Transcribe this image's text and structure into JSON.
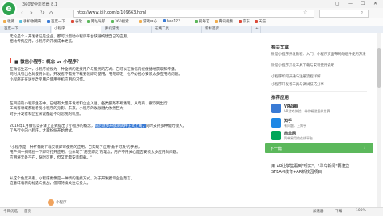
{
  "window": {
    "title": "360安全浏览器 8.1",
    "logo": "e",
    "controls": [
      "▢",
      "—",
      "☐",
      "✕"
    ]
  },
  "address": {
    "url": "http://www.itilr.com/p/109663.html",
    "nav_icons": [
      "back-icon",
      "forward-icon",
      "refresh-icon",
      "home-icon"
    ],
    "search_placeholder": ""
  },
  "bookmarks": [
    {
      "label": "收藏",
      "color": "#f0ad4e"
    },
    {
      "label": "手机收藏夹",
      "color": "#5bc0de"
    },
    {
      "label": "百度一下",
      "color": "#3a7bd5"
    },
    {
      "label": "谷歌",
      "color": "#dd4b39"
    },
    {
      "label": "网址导航",
      "color": "#5cb85c"
    },
    {
      "label": "360搜索",
      "color": "#5cb85c"
    },
    {
      "label": "游戏中心",
      "color": "#f0ad4e"
    },
    {
      "label": "hao123",
      "color": "#3a7bd5"
    },
    {
      "label": "爱奇艺",
      "color": "#5cb85c"
    },
    {
      "label": "腾讯视频",
      "color": "#f0ad4e"
    },
    {
      "label": "京东",
      "color": "#dd4b39"
    },
    {
      "label": "天猫",
      "color": "#dd4b39"
    }
  ],
  "tabs": [
    {
      "label": "百度一下",
      "active": false
    },
    {
      "label": "小程序",
      "active": true
    },
    {
      "label": "手机游戏",
      "active": false
    },
    {
      "label": "在线工具",
      "active": false
    },
    {
      "label": "新标签页",
      "active": false
    },
    {
      "label": "+",
      "active": false
    }
  ],
  "article": {
    "intro": [
      "无论是个人开发者还是企业，都可以借助小程序平台快速构建自己的应用。",
      "相比传统应用，小程序的开发成本更低。"
    ],
    "section_title": "■ 微信小程序：概念 or 小程序？",
    "paragraphs": [
      [
        "在微信生态中，小程序被视为一种全新的连接用户与服务的方式。它可以在微信内被便捷地获取和传播，",
        "同时具有出色的使用体验。开发者不需要下载安装即可使用，用完即走，也不必担心安装太多应用的问题。",
        "小程序正在逐步改变用户使用手机应用的习惯。"
      ],
      [
        "在目前的小程序生态中，已经有大量开发者和企业入驻，各类服务不断涌现，从电商、餐饮到出行、",
        "工具等领域都能看到小程序的身影。未来，小程序的发展潜力依然巨大，",
        "对于开发者和企业来说都是不可忽视的机会。"
      ]
    ],
    "selected_line_before": "2016年1月微信公开课上正式提出了小程序的概念，",
    "selected_text": "随后逐步开放测试并正式上线，",
    "selected_line_after": "同时支持多种能力接入。",
    "para3_rest": [
      "了各行业的小程序，大家纷纷开始尝试。"
    ],
    "quote": [
      "\"小程序是一种不需要下载安装即可使用的应用，它实现了应用'触手可及'的梦想，",
      "用户扫一扫或搜一下即可打开应用。也体现了'用完即走'的理念，用户不用关心是否安装太多应用的问题。",
      "应用将无处不在，随时可用，但又无需安装卸载。\""
    ],
    "closing": [
      "从这个角度来看，小程序更像是一种新的连接方式。对于开发者和企业而言，",
      "这意味着新的机遇与挑战，值得持续关注与投入。"
    ],
    "author": "小程序"
  },
  "sidebar": {
    "heading": "相关文章",
    "items": [
      "微信小程序开发教程：入门、小程序页面布局与组件使用方法",
      "微信小程序开发工具下载与安装使用说明",
      "小程序如何开通与注册流程详解",
      "小程序开发者工具与调试技巧分享"
    ],
    "apps_heading": "推荐应用",
    "apps": [
      {
        "name": "VR战舰",
        "desc": "VR游戏体验，带你畅游虚拟世界",
        "color": "#3a7bd5"
      },
      {
        "name": "知乎",
        "desc": "有问题，上知乎",
        "color": "#1e88e5"
      },
      {
        "name": "简单网",
        "desc": "简单易用的在线平台",
        "color": "#00a65a"
      }
    ],
    "download_label": "下一篇",
    "download_arrow": "›",
    "ad_lines": [
      "用 AR让学生看到\"现实\"，\"寻乌新闻\"要建立",
      "STEAM教育+AR新校园项目"
    ]
  },
  "status": {
    "left_items": [
      "今日优选",
      "首页"
    ],
    "right_items": [
      "加速器",
      "下载",
      "100%"
    ]
  }
}
